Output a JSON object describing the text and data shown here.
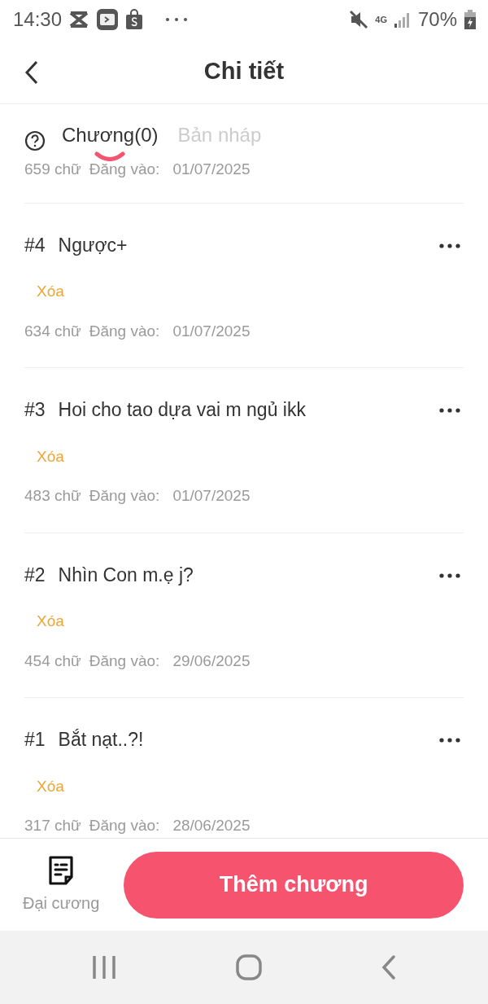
{
  "status_bar": {
    "time": "14:30",
    "network": "4G",
    "battery": "70%"
  },
  "header": {
    "title": "Chi tiết"
  },
  "tabs": [
    {
      "label": "Chương(0)",
      "selected": true
    },
    {
      "label": "Bản nháp",
      "selected": false
    }
  ],
  "top_meta": {
    "words": "659 chữ",
    "label": "Đăng vào:",
    "date": "01/07/2025"
  },
  "chapters": [
    {
      "number": "#4",
      "title": "Ngược+",
      "action": "Xóa",
      "words": "634 chữ",
      "label": "Đăng vào:",
      "date": "01/07/2025"
    },
    {
      "number": "#3",
      "title": "Hoi cho tao dựa vai m ngủ ikk",
      "action": "Xóa",
      "words": "483 chữ",
      "label": "Đăng vào:",
      "date": "01/07/2025"
    },
    {
      "number": "#2",
      "title": "Nhìn Con m.ẹ j?",
      "action": "Xóa",
      "words": "454 chữ",
      "label": "Đăng vào:",
      "date": "29/06/2025"
    },
    {
      "number": "#1",
      "title": "Bắt nạt..?!",
      "action": "Xóa",
      "words": "317 chữ",
      "label": "Đăng vào:",
      "date": "28/06/2025"
    }
  ],
  "footer": {
    "outline_label": "Đại cương",
    "add_button": "Thêm chương"
  }
}
